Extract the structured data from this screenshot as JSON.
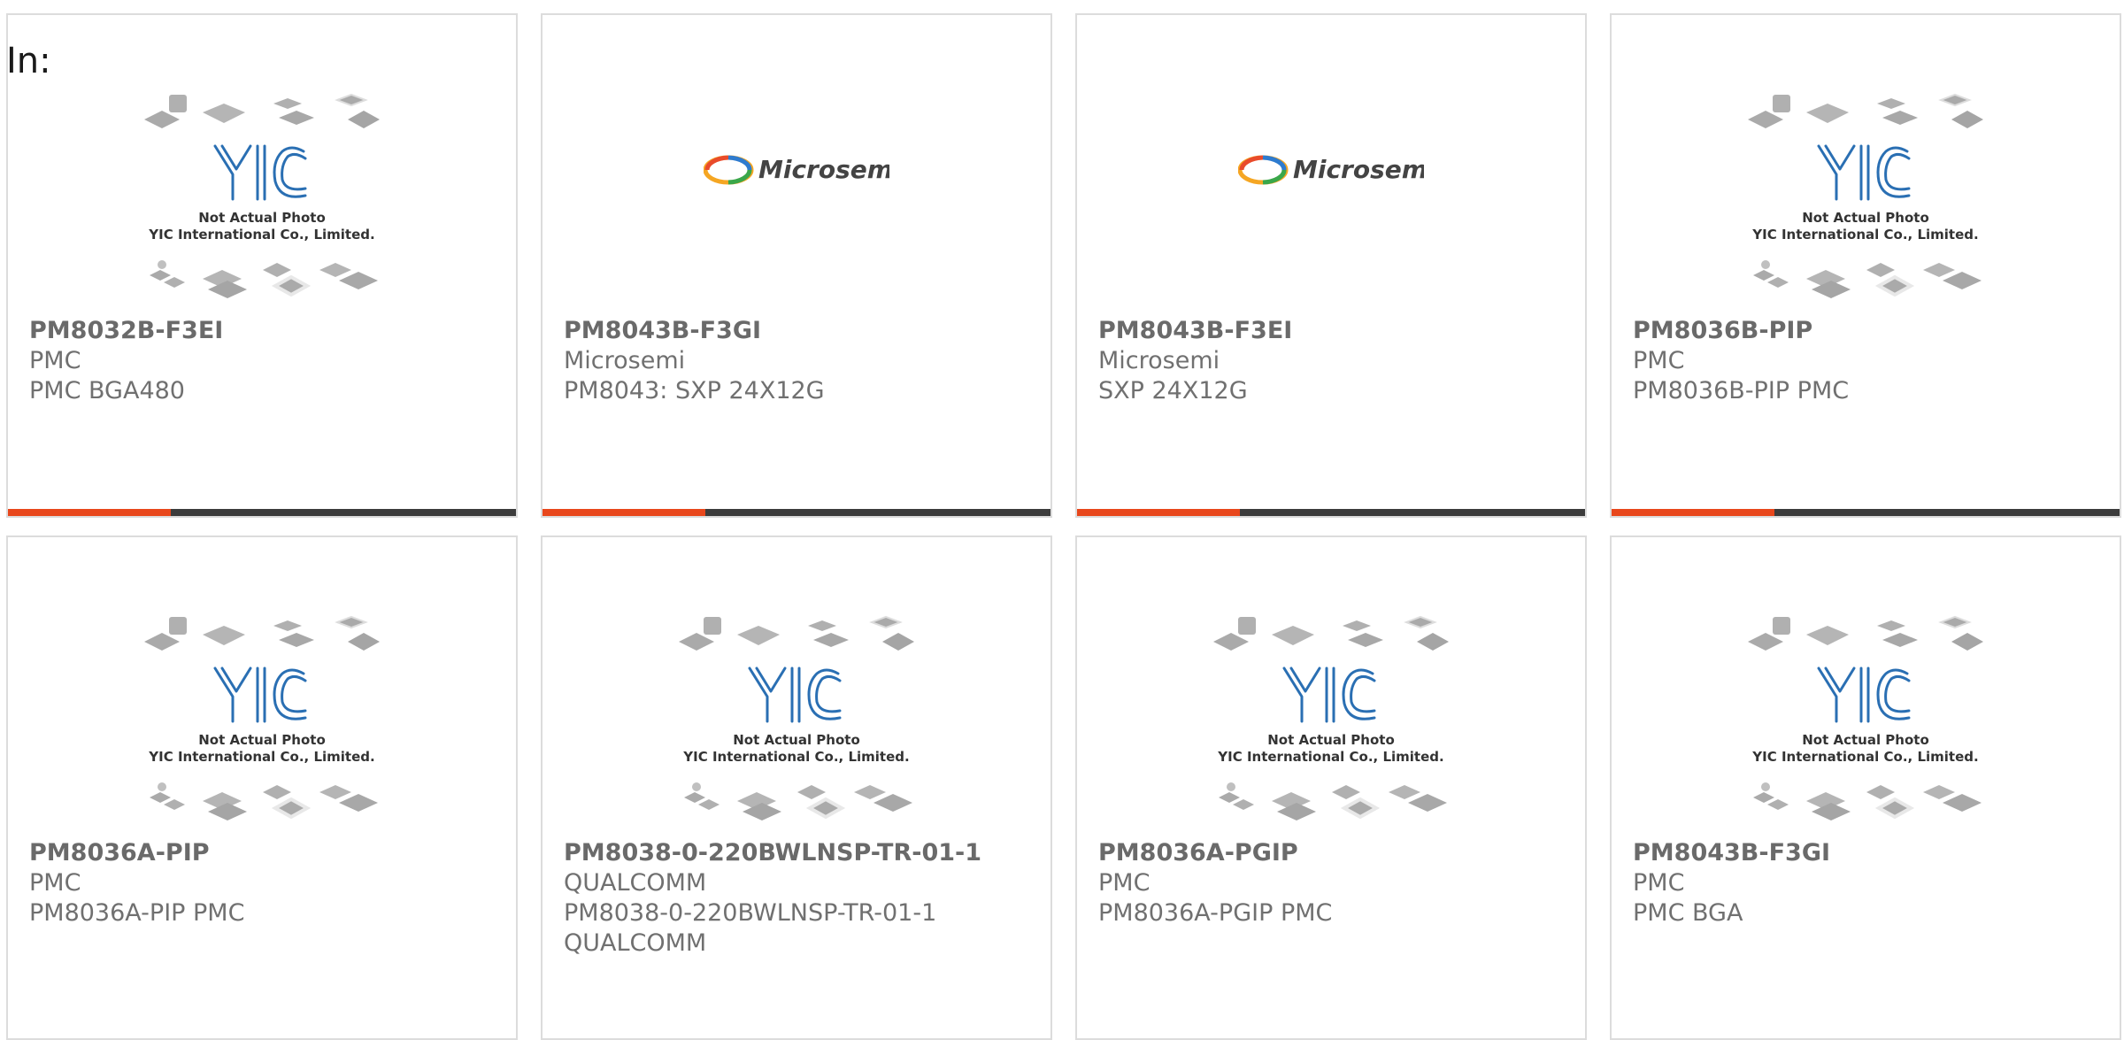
{
  "header": {
    "prefix": "In:"
  },
  "placeholder_image": {
    "caption_line1": "Not Actual Photo",
    "caption_line2": "YIC International Co., Limited.",
    "logo_letters": "YIC"
  },
  "microsemi_logo_text": "Microsemi",
  "colors": {
    "accent": "#e8471c",
    "bar_dark": "#3c3c3c",
    "yic_blue": "#2a6fb3",
    "text": "#707070"
  },
  "products": [
    {
      "part_number": "PM8032B-F3EI",
      "manufacturer": "PMC",
      "description": "PMC BGA480",
      "image": "yic-placeholder"
    },
    {
      "part_number": "PM8043B-F3GI",
      "manufacturer": "Microsemi",
      "description": "PM8043: SXP 24X12G",
      "image": "microsemi-logo"
    },
    {
      "part_number": "PM8043B-F3EI",
      "manufacturer": "Microsemi",
      "description": "SXP 24X12G",
      "image": "microsemi-logo"
    },
    {
      "part_number": "PM8036B-PIP",
      "manufacturer": "PMC",
      "description": "PM8036B-PIP PMC",
      "image": "yic-placeholder"
    },
    {
      "part_number": "PM8036A-PIP",
      "manufacturer": "PMC",
      "description": "PM8036A-PIP PMC",
      "image": "yic-placeholder"
    },
    {
      "part_number": "PM8038-0-220BWLNSP-TR-01-1",
      "manufacturer": "QUALCOMM",
      "description": "PM8038-0-220BWLNSP-TR-01-1 QUALCOMM",
      "image": "yic-placeholder"
    },
    {
      "part_number": "PM8036A-PGIP",
      "manufacturer": "PMC",
      "description": "PM8036A-PGIP PMC",
      "image": "yic-placeholder"
    },
    {
      "part_number": "PM8043B-F3GI",
      "manufacturer": "PMC",
      "description": "PMC BGA",
      "image": "yic-placeholder"
    }
  ]
}
